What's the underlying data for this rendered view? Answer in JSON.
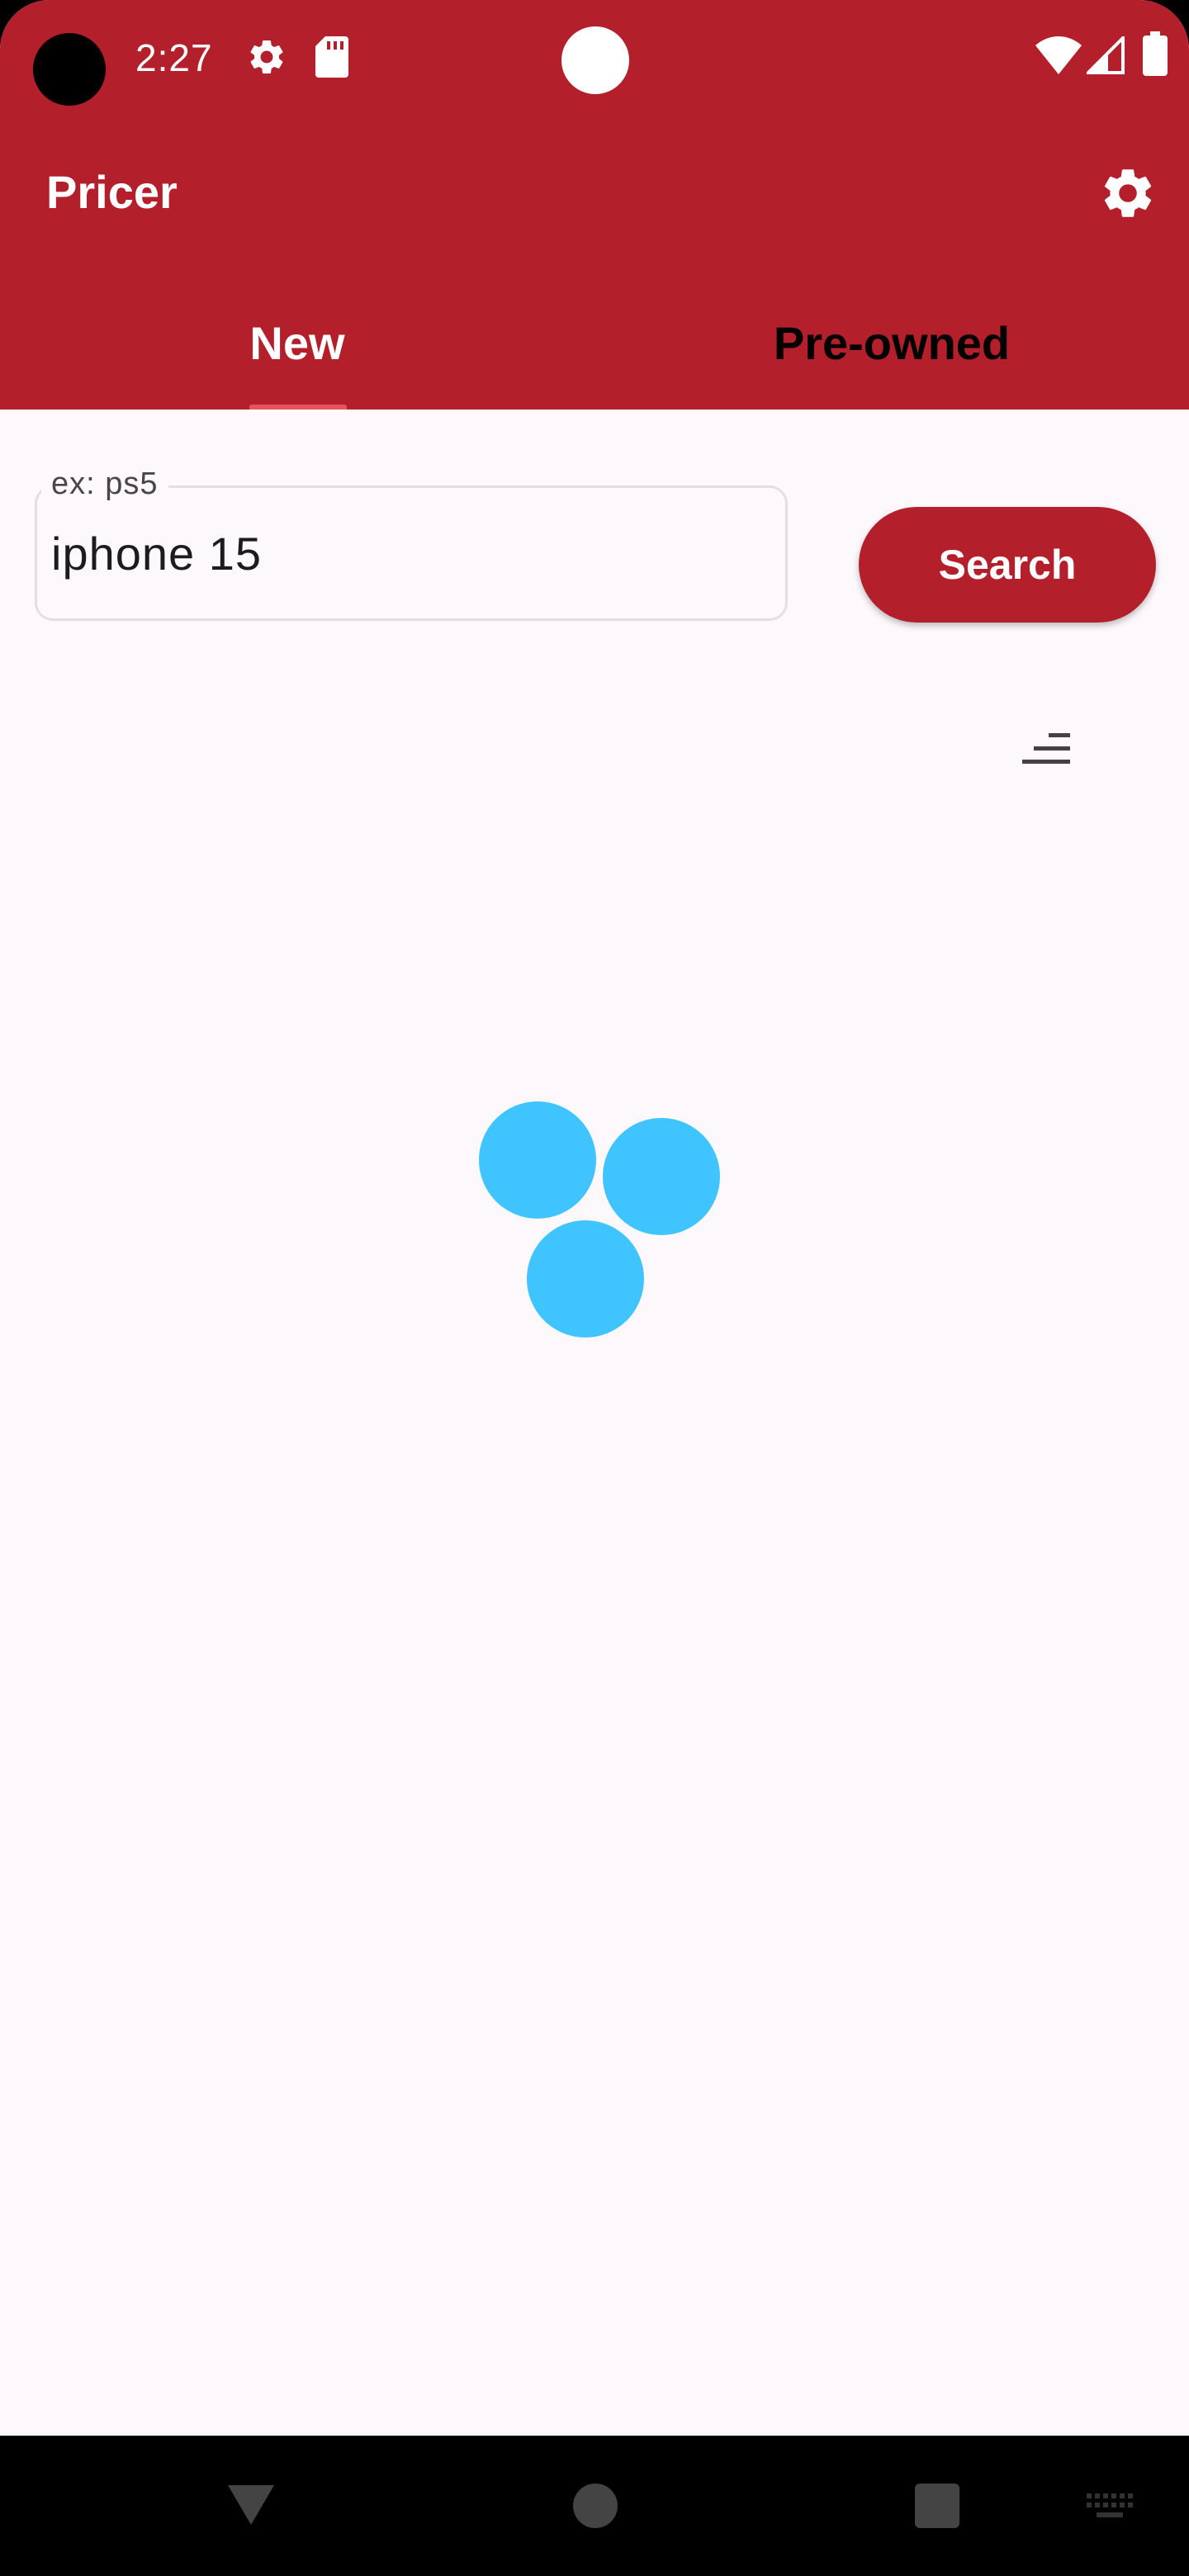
{
  "status_bar": {
    "time": "2:27"
  },
  "app_bar": {
    "title": "Pricer"
  },
  "tabs": [
    {
      "label": "New",
      "selected": true
    },
    {
      "label": "Pre-owned",
      "selected": false
    }
  ],
  "search": {
    "label": "ex: ps5",
    "value": "iphone 15",
    "button_label": "Search"
  },
  "colors": {
    "primary": "#b31f2b",
    "background": "#fdf8fc",
    "loader": "#40c4ff",
    "tab_indicator": "#e8525c"
  },
  "icons": {
    "status_settings": "gear-icon",
    "status_sd": "sd-card-icon",
    "wifi": "wifi-icon",
    "signal": "signal-icon",
    "battery": "battery-icon",
    "settings": "gear-icon",
    "sort": "sort-icon",
    "nav_back": "back-triangle-icon",
    "nav_home": "home-circle-icon",
    "nav_recents": "recents-square-icon",
    "keyboard": "keyboard-icon"
  }
}
